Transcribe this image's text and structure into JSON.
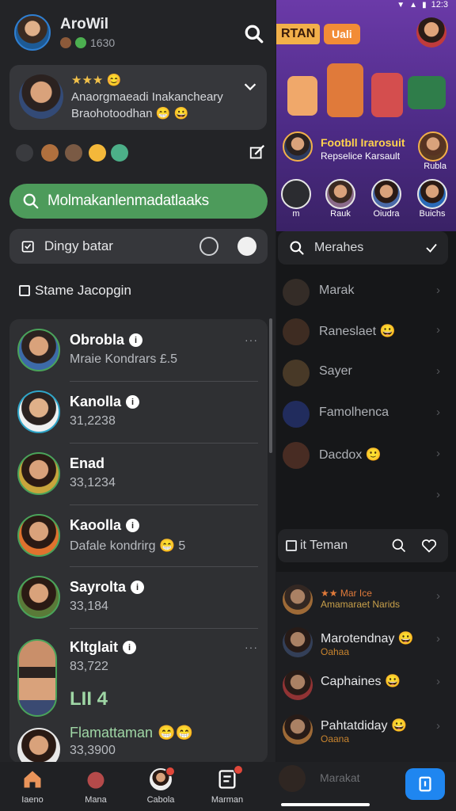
{
  "colors": {
    "accent_green": "#4d9b5b",
    "brand_blue": "#1f86f0",
    "badge_red": "#e0473a",
    "banner_purple": "#5b2f98"
  },
  "status_bar": {
    "time": "12:3"
  },
  "header": {
    "name": "AroWil",
    "sub": "1630",
    "search_icon": "search-icon"
  },
  "featured": {
    "title": "&#9733;&#9733;&#9733;",
    "line1": "Anaorgmaeadi Inakancheary",
    "line2": "Braohotoodhan"
  },
  "green_button": {
    "label": "Molmakanlenmadatlaaks"
  },
  "search": {
    "label": "Dingy batar"
  },
  "section": {
    "label": "Stame Jacopgin"
  },
  "chats": [
    {
      "name": "Obrobla",
      "msg": "Mraie Kondrars £.5",
      "more": "···"
    },
    {
      "name": "Kanolla",
      "msg": "31,2238",
      "more": ""
    },
    {
      "name": "Enad",
      "msg": "33,1234",
      "more": ""
    },
    {
      "name": "Kaoolla",
      "msg": "Dafale kondrirg",
      "more": ""
    },
    {
      "name": "Sayrolta",
      "msg": "33,184",
      "more": ""
    },
    {
      "name": "Kltglait",
      "msg": "83,722",
      "big": "LII 4",
      "more": "···"
    },
    {
      "name": "Flamattaman",
      "msg": "33,3900",
      "more": ""
    }
  ],
  "right_panel": {
    "banner": {
      "tag1": "RTAN",
      "tag2": "Uali",
      "title": "Footbll Irarosuit",
      "subtitle": "Repselice Karsault",
      "side_label": "Rubla"
    },
    "stories": [
      {
        "label": "m"
      },
      {
        "label": "Rauk"
      },
      {
        "label": "Oiudra"
      },
      {
        "label": "Buichs"
      }
    ],
    "search_label": "Merahes",
    "items": [
      {
        "name": "Marak"
      },
      {
        "name": "Raneslaet"
      },
      {
        "name": "Sayer"
      },
      {
        "name": "Famolhenca"
      },
      {
        "name": "Dacdox"
      },
      {
        "name": ""
      }
    ],
    "tab_label": "it Teman",
    "list2": [
      {
        "name": "Mar Ice",
        "sub": "Amamaraet Narids"
      },
      {
        "name": "Marotendnay",
        "sub": "Oahaa"
      },
      {
        "name": "Caphaines",
        "sub": ""
      },
      {
        "name": "Pahtatdiday",
        "sub": "Oaana"
      }
    ]
  },
  "bottom_nav": [
    {
      "label": "Iaeno",
      "icon": "home-icon"
    },
    {
      "label": "Mana",
      "icon": "heart-icon"
    },
    {
      "label": "Cabola",
      "icon": "avatar-icon"
    },
    {
      "label": "Marman",
      "icon": "document-icon"
    }
  ],
  "ghost_text": "Marakat"
}
